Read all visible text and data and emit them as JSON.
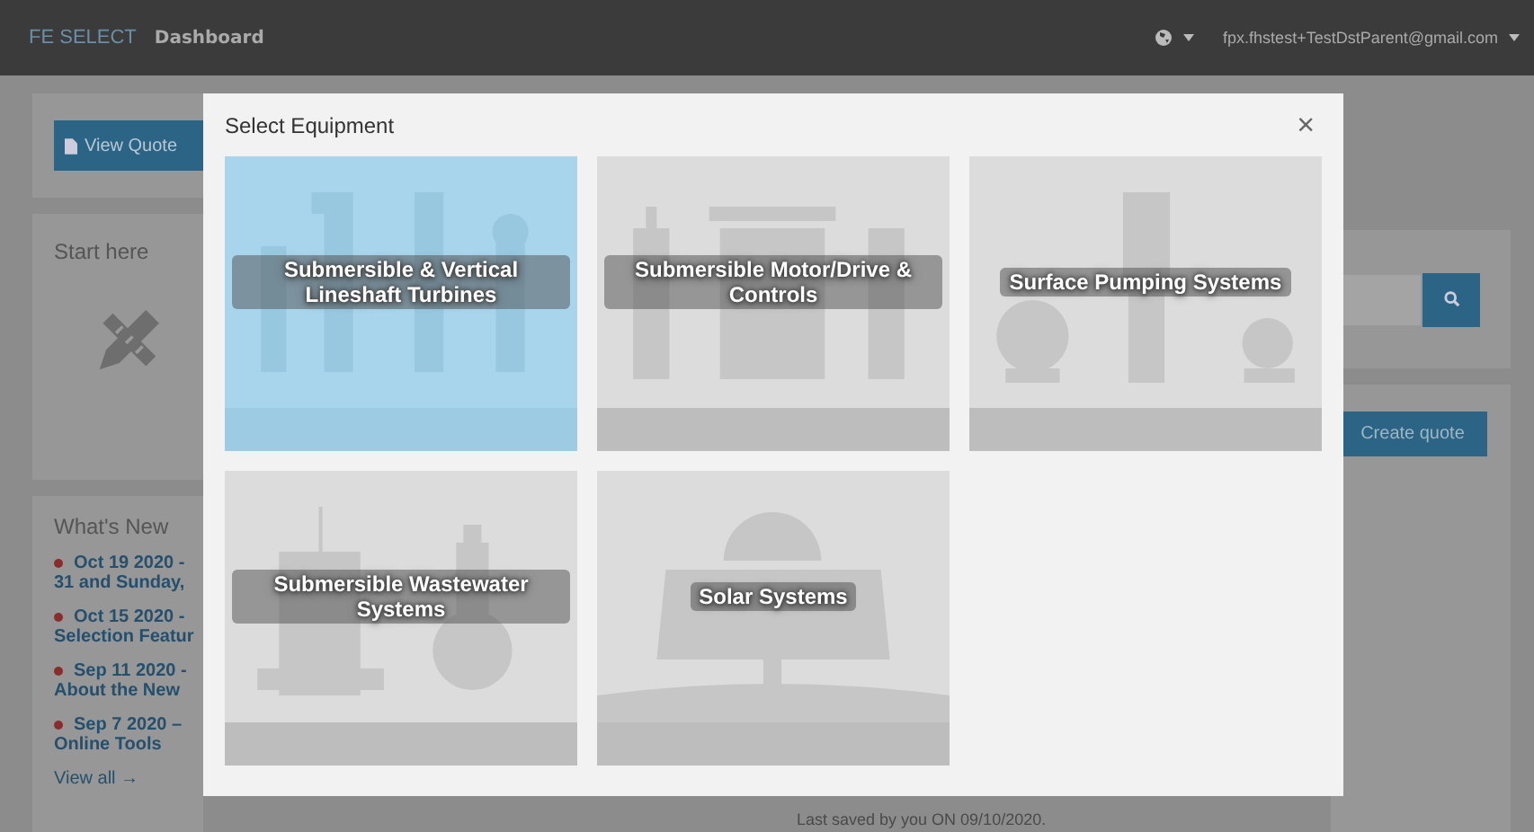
{
  "navbar": {
    "logo": "FE SELECT",
    "title": "Dashboard",
    "user": "fpx.fhstest+TestDstParent@gmail.com"
  },
  "quote_panel": {
    "button": "View Quote"
  },
  "start_panel": {
    "title": "Start here"
  },
  "whats_new": {
    "title": "What's New",
    "items": [
      {
        "date": "Oct 19 2020 -",
        "text": "31 and Sunday,"
      },
      {
        "date": "Oct 15 2020 -",
        "text": "Selection Featur"
      },
      {
        "date": "Sep 11 2020 -",
        "text": "About the New"
      },
      {
        "date": "Sep 7 2020 –",
        "text": "Online Tools"
      }
    ],
    "link": "View all →"
  },
  "right": {
    "create_button": "Create quote",
    "last_saved": "Last saved by you ON 09/10/2020."
  },
  "modal": {
    "title": "Select Equipment",
    "close": "×",
    "tiles": [
      {
        "label": "Submersible & Vertical Lineshaft Turbines",
        "kind": "turbines",
        "selected": true
      },
      {
        "label": "Submersible Motor/Drive & Controls",
        "kind": "motor",
        "selected": false
      },
      {
        "label": "Surface Pumping Systems",
        "kind": "surface",
        "selected": false
      },
      {
        "label": "Submersible Wastewater Systems",
        "kind": "wastewater",
        "selected": false
      },
      {
        "label": "Solar Systems",
        "kind": "solar",
        "selected": false
      }
    ]
  }
}
